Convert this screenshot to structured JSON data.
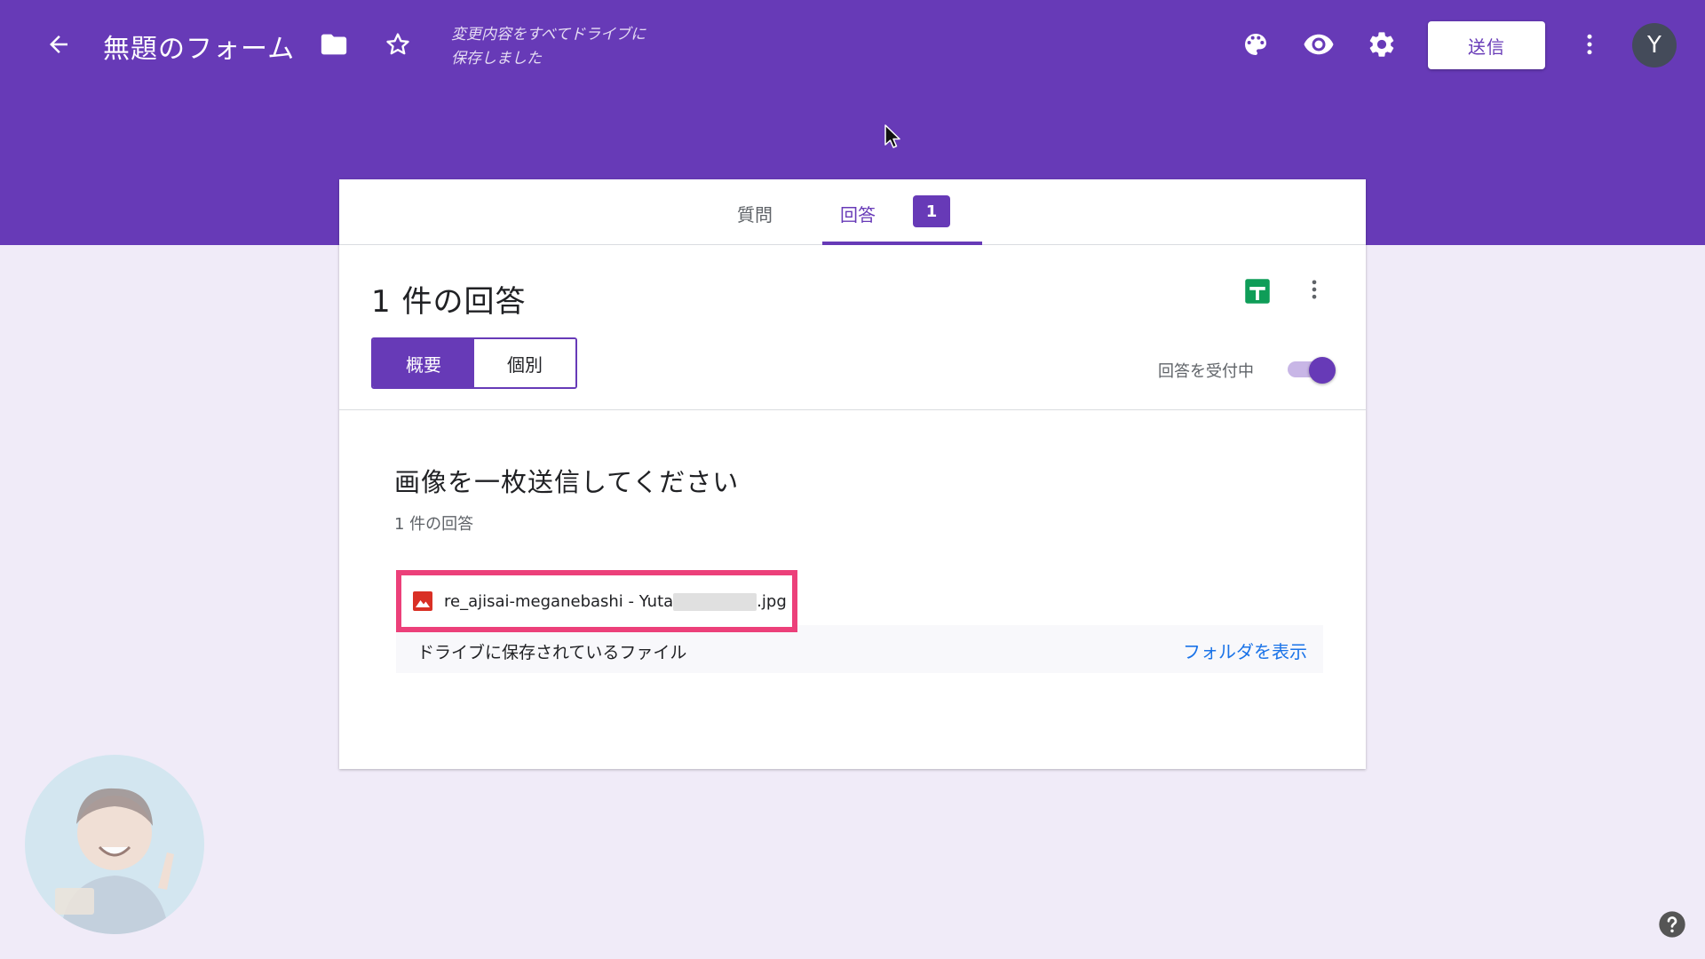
{
  "header": {
    "title": "無題のフォーム",
    "saved_status_line1": "変更内容をすべてドライブに",
    "saved_status_line2": "保存しました",
    "send_label": "送信",
    "avatar_initial": "Y"
  },
  "tabs": {
    "questions_label": "質問",
    "responses_label": "回答",
    "responses_badge": "1"
  },
  "responses": {
    "count_title": "1 件の回答",
    "summary_label": "概要",
    "individual_label": "個別",
    "accepting_label": "回答を受付中",
    "accepting_on": true
  },
  "question": {
    "title": "画像を一枚送信してください",
    "count": "1 件の回答",
    "file_name_prefix": "re_ajisai-meganebashi - Yuta",
    "file_name_suffix": ".jpg",
    "drive_label": "ドライブに保存されているファイル",
    "show_folder_label": "フォルダを表示"
  },
  "colors": {
    "brand": "#673ab7",
    "page_bg": "#f0ebf8",
    "highlight": "#ec407a",
    "link": "#1a73e8",
    "sheets_green": "#0f9d58",
    "image_icon_red": "#d93025"
  },
  "icons": [
    "arrow-back-icon",
    "folder-icon",
    "star-outline-icon",
    "palette-icon",
    "eye-icon",
    "gear-icon",
    "more-vert-icon",
    "sheets-icon",
    "image-file-icon",
    "help-icon",
    "cursor-icon"
  ]
}
